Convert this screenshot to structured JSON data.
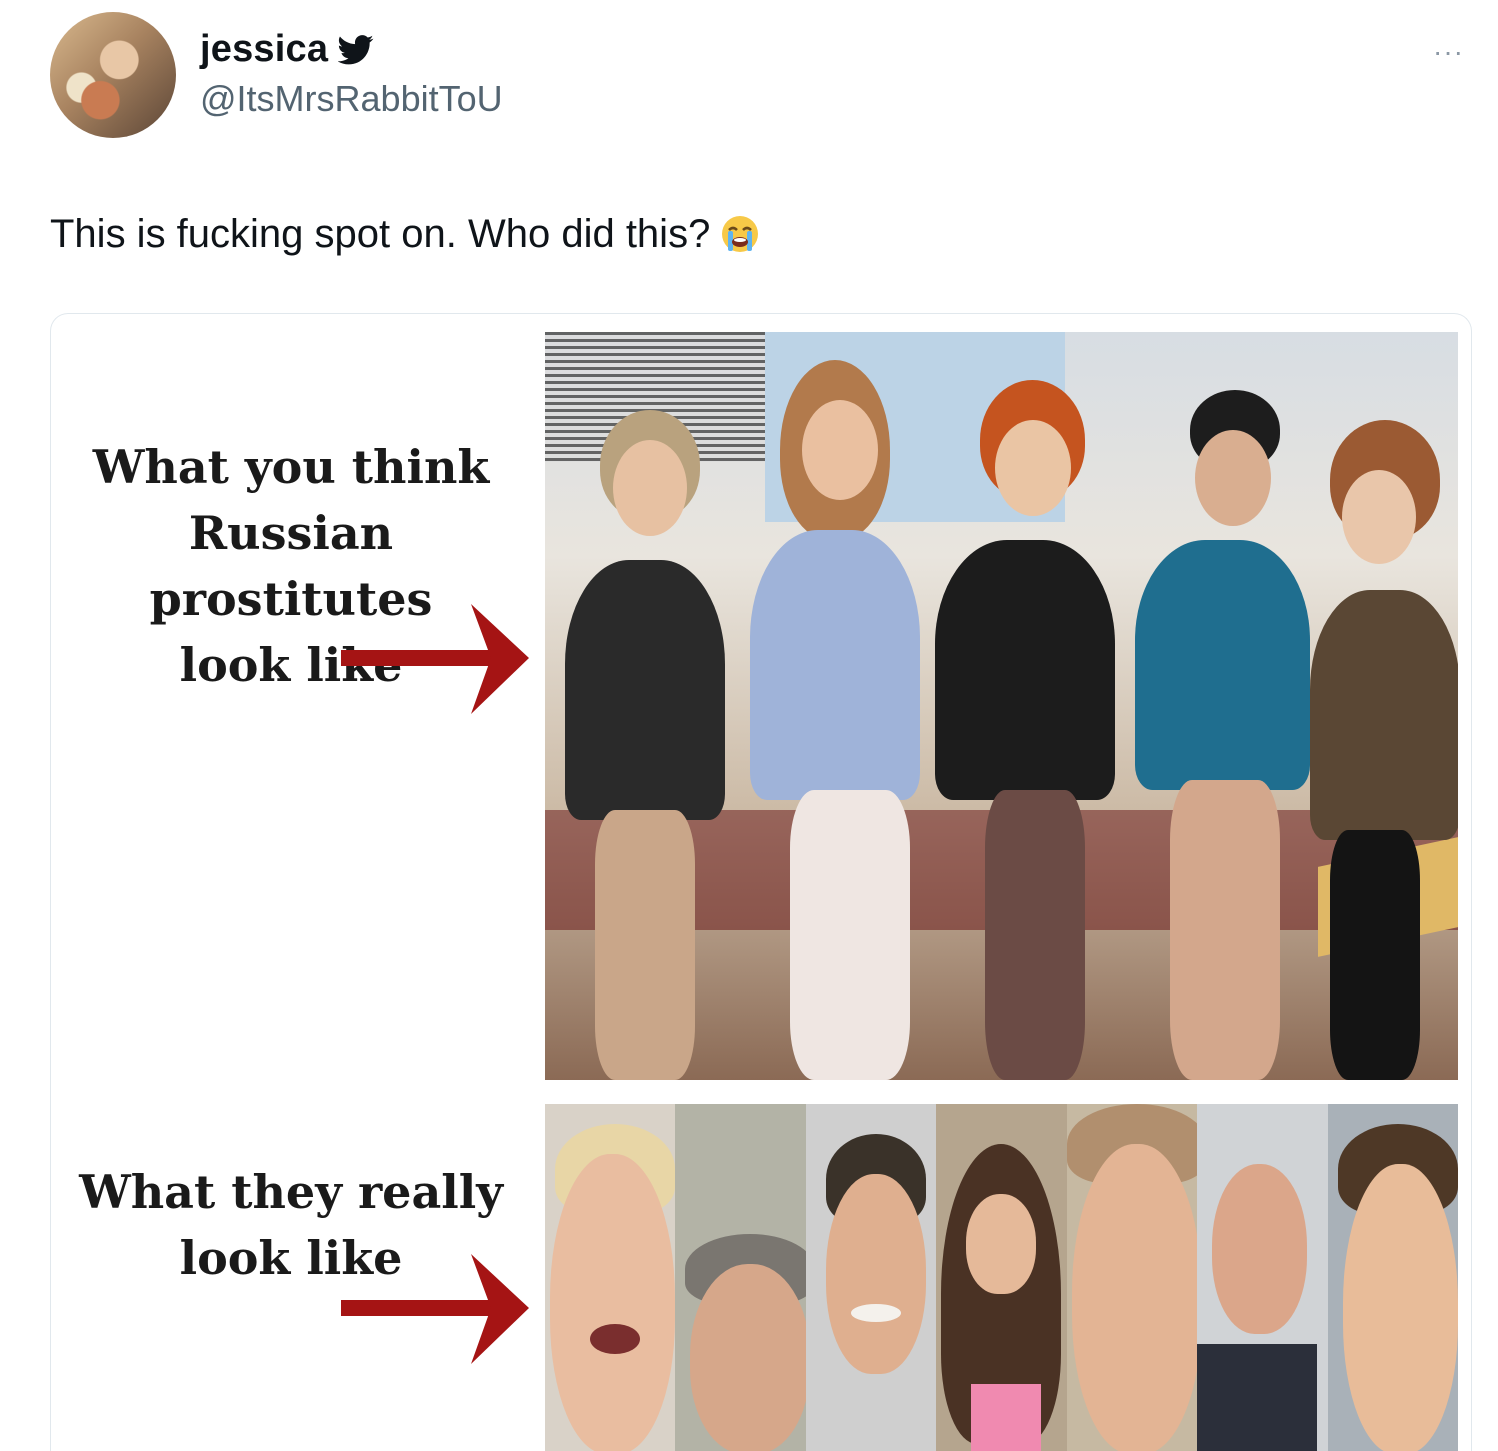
{
  "tweet": {
    "display_name": "jessica",
    "handle": "@ItsMrsRabbitToU",
    "text": "This is fucking spot on. Who did this?",
    "more_label": "···",
    "avatar_icon": "user-avatar",
    "verified_icon": "twitter-bird-icon",
    "emoji_icon": "loudly-crying-face-icon"
  },
  "meme": {
    "caption_top_lines": [
      "What you think",
      "Russian prostitutes",
      "look like"
    ],
    "caption_bottom_lines": [
      "What they really",
      "look like"
    ],
    "arrow_color": "#a51414"
  },
  "colors": {
    "accent": "#1d9bf0",
    "text": "#0f1419",
    "secondary": "#536471"
  }
}
